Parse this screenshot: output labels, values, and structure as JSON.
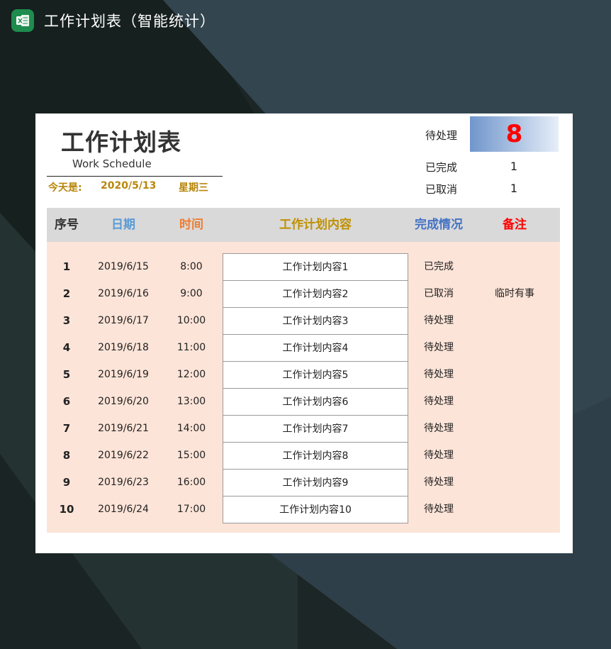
{
  "app": {
    "title": "工作计划表（智能统计）",
    "icon": "excel-icon",
    "icon_letter": "X",
    "icon_color": "#1e8c4e"
  },
  "sheet": {
    "title": "工作计划表",
    "subtitle": "Work Schedule",
    "today": {
      "label": "今天是:",
      "date": "2020/5/13",
      "weekday": "星期三"
    },
    "stats": [
      {
        "label": "待处理",
        "value": "8"
      },
      {
        "label": "已完成",
        "value": "1"
      },
      {
        "label": "已取消",
        "value": "1"
      }
    ],
    "columns": [
      {
        "label": "序号",
        "color": "#333333"
      },
      {
        "label": "日期",
        "color": "#5b9bd5"
      },
      {
        "label": "时间",
        "color": "#ed7d31"
      },
      {
        "label": "工作计划内容",
        "color": "#bf9000"
      },
      {
        "label": "完成情况",
        "color": "#4472c4"
      },
      {
        "label": "备注",
        "color": "#ff0000"
      }
    ],
    "rows": [
      {
        "seq": "1",
        "date": "2019/6/15",
        "time": "8:00",
        "content": "工作计划内容1",
        "status": "已完成",
        "note": ""
      },
      {
        "seq": "2",
        "date": "2019/6/16",
        "time": "9:00",
        "content": "工作计划内容2",
        "status": "已取消",
        "note": "临时有事"
      },
      {
        "seq": "3",
        "date": "2019/6/17",
        "time": "10:00",
        "content": "工作计划内容3",
        "status": "待处理",
        "note": ""
      },
      {
        "seq": "4",
        "date": "2019/6/18",
        "time": "11:00",
        "content": "工作计划内容4",
        "status": "待处理",
        "note": ""
      },
      {
        "seq": "5",
        "date": "2019/6/19",
        "time": "12:00",
        "content": "工作计划内容5",
        "status": "待处理",
        "note": ""
      },
      {
        "seq": "6",
        "date": "2019/6/20",
        "time": "13:00",
        "content": "工作计划内容6",
        "status": "待处理",
        "note": ""
      },
      {
        "seq": "7",
        "date": "2019/6/21",
        "time": "14:00",
        "content": "工作计划内容7",
        "status": "待处理",
        "note": ""
      },
      {
        "seq": "8",
        "date": "2019/6/22",
        "time": "15:00",
        "content": "工作计划内容8",
        "status": "待处理",
        "note": ""
      },
      {
        "seq": "9",
        "date": "2019/6/23",
        "time": "16:00",
        "content": "工作计划内容9",
        "status": "待处理",
        "note": ""
      },
      {
        "seq": "10",
        "date": "2019/6/24",
        "time": "17:00",
        "content": "工作计划内容10",
        "status": "待处理",
        "note": ""
      }
    ]
  },
  "colors": {
    "accent_today": "#b8860b",
    "header_bg": "#d9d9d9",
    "body_bg": "#fde4d8",
    "pending_box_from": "#7096cc",
    "pending_box_to": "#e6eef8",
    "pending_value": "#ff0000"
  }
}
